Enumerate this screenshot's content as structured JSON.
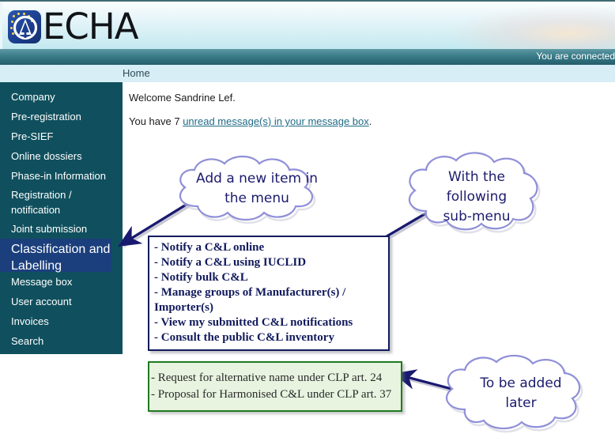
{
  "brand": {
    "logo_text": "ECHA",
    "logo_icon": "echa-logo-icon"
  },
  "header": {
    "connected_text": "You are connected",
    "breadcrumb": "Home"
  },
  "sidebar": {
    "items": [
      {
        "label": "Company",
        "active": false
      },
      {
        "label": "Pre-registration",
        "active": false
      },
      {
        "label": "Pre-SIEF",
        "active": false
      },
      {
        "label": "Online dossiers",
        "active": false
      },
      {
        "label": "Phase-in Information",
        "active": false
      },
      {
        "label": "Registration / notification",
        "active": false
      },
      {
        "label": "Joint submission",
        "active": false
      },
      {
        "label": "Classification and Labelling",
        "active": true
      },
      {
        "label": "Message box",
        "active": false
      },
      {
        "label": "User account",
        "active": false
      },
      {
        "label": "Invoices",
        "active": false
      },
      {
        "label": "Search",
        "active": false
      }
    ]
  },
  "main": {
    "welcome": "Welcome Sandrine Lef.",
    "message_prefix": "You have 7 ",
    "message_link": "unread message(s) in your message box",
    "message_suffix": ".",
    "unread_count": "7"
  },
  "menu_box": {
    "items": [
      "- Notify a C&L online",
      "- Notify a C&L using IUCLID",
      "- Notify bulk C&L",
      "- Manage groups of Manufacturer(s) / Importer(s)",
      "- View my submitted C&L notifications",
      "- Consult the public C&L inventory"
    ]
  },
  "green_box": {
    "items": [
      "- Request for alternative name under CLP art. 24",
      "- Proposal for Harmonised C&L under CLP art. 37"
    ]
  },
  "callouts": [
    {
      "text": "Add a new item in\nthe menu",
      "name": "callout-add-new-item"
    },
    {
      "text": "With the\nfollowing\nsub-menu",
      "name": "callout-sub-menu"
    },
    {
      "text": "To be added\nlater",
      "name": "callout-to-be-added-later"
    }
  ],
  "colors": {
    "sidebar_bg": "#10505e",
    "sidebar_active_bg": "#1b3f7c",
    "connected_bar": "#2d6b78",
    "breadcrumb_bg": "#d7eef6",
    "navy_box_border": "#111a5c",
    "green_box_border": "#1f7a1f",
    "green_box_bg": "#e8f4e0",
    "cloud_outline": "#8f8fd8",
    "arrow": "#191970",
    "link": "#1f6b86"
  }
}
